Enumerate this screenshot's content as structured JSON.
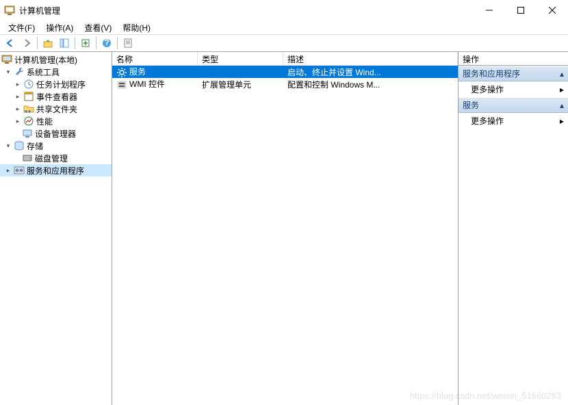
{
  "window": {
    "title": "计算机管理"
  },
  "menu": {
    "file": "文件(F)",
    "action": "操作(A)",
    "view": "查看(V)",
    "help": "帮助(H)"
  },
  "tree": {
    "root": "计算机管理(本地)",
    "system_tools": "系统工具",
    "task_scheduler": "任务计划程序",
    "event_viewer": "事件查看器",
    "shared_folders": "共享文件夹",
    "performance": "性能",
    "device_manager": "设备管理器",
    "storage": "存储",
    "disk_management": "磁盘管理",
    "services_apps": "服务和应用程序"
  },
  "list": {
    "columns": {
      "name": "名称",
      "type": "类型",
      "description": "描述"
    },
    "col_widths": {
      "name": 125,
      "type": 125,
      "description": 200
    },
    "rows": [
      {
        "icon": "gear-icon",
        "name": "服务",
        "type": "",
        "description": "启动、终止并设置 Wind...",
        "selected": true
      },
      {
        "icon": "wmi-icon",
        "name": "WMI 控件",
        "type": "扩展管理单元",
        "description": "配置和控制 Windows M...",
        "selected": false
      }
    ]
  },
  "actions": {
    "header": "操作",
    "section1_title": "服务和应用程序",
    "section1_link": "更多操作",
    "section2_title": "服务",
    "section2_link": "更多操作"
  },
  "watermark": "https://blog.csdn.net/weixin_51660283"
}
